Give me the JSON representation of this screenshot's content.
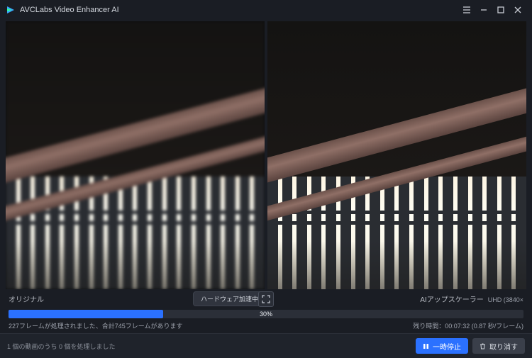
{
  "app": {
    "title": "AVCLabs Video Enhancer AI"
  },
  "compare": {
    "left_label": "オリジナル",
    "right_label": "AIアップスケーラー",
    "resolution_label": "UHD (3840×",
    "hw_accel_chip": "ハードウェア加速中",
    "icons": {
      "expand": "expand-icon"
    }
  },
  "progress": {
    "percent": 30,
    "percent_label": "30%",
    "frames_status": "227フレームが処理されました、合計745フレームがあります",
    "remaining_label": "残り時間：00:07:32 (0.87 秒/フレーム)"
  },
  "footer": {
    "queue_status": "1 個の動画のうち 0 個を処理しました",
    "pause_label": "一時停止",
    "cancel_label": "取り消す"
  },
  "colors": {
    "accent": "#2b71ff",
    "bg": "#1a1d24",
    "panel": "#2b2f38"
  }
}
